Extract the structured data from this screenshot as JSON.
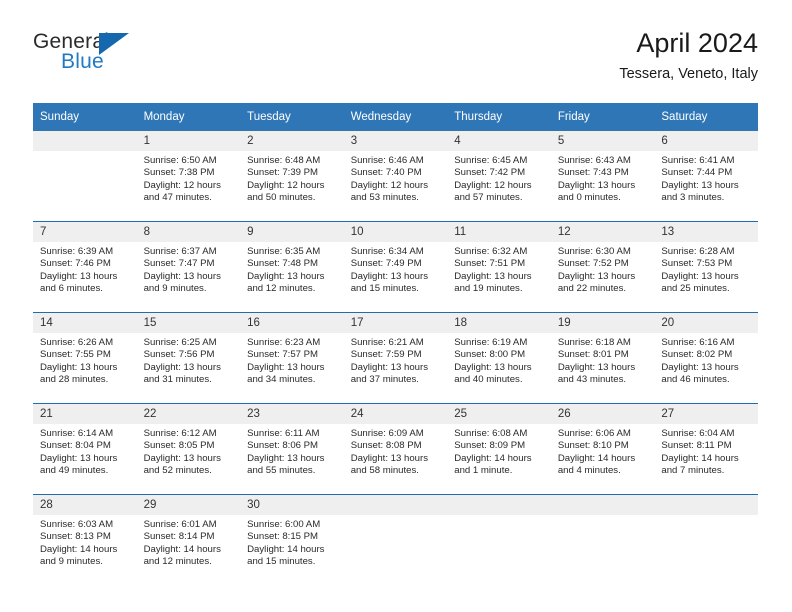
{
  "brand": {
    "name_top": "General",
    "name_bottom": "Blue",
    "flag_icon": "triangle-flag-icon"
  },
  "header": {
    "title": "April 2024",
    "subtitle": "Tessera, Veneto, Italy"
  },
  "colors": {
    "header_blue": "#2F76B6",
    "divider_blue": "#1F6CB0",
    "daynum_bg": "#EFEFEF",
    "brand_blue": "#1F7AC4",
    "text": "#1A1A1A"
  },
  "calendar": {
    "weekdays": [
      "Sunday",
      "Monday",
      "Tuesday",
      "Wednesday",
      "Thursday",
      "Friday",
      "Saturday"
    ],
    "labels": {
      "sunrise": "Sunrise:",
      "sunset": "Sunset:",
      "daylight": "Daylight:"
    },
    "weeks": [
      [
        {
          "day": "",
          "sunrise": "",
          "sunset": "",
          "daylight": ""
        },
        {
          "day": "1",
          "sunrise": "Sunrise: 6:50 AM",
          "sunset": "Sunset: 7:38 PM",
          "daylight": "Daylight: 12 hours and 47 minutes."
        },
        {
          "day": "2",
          "sunrise": "Sunrise: 6:48 AM",
          "sunset": "Sunset: 7:39 PM",
          "daylight": "Daylight: 12 hours and 50 minutes."
        },
        {
          "day": "3",
          "sunrise": "Sunrise: 6:46 AM",
          "sunset": "Sunset: 7:40 PM",
          "daylight": "Daylight: 12 hours and 53 minutes."
        },
        {
          "day": "4",
          "sunrise": "Sunrise: 6:45 AM",
          "sunset": "Sunset: 7:42 PM",
          "daylight": "Daylight: 12 hours and 57 minutes."
        },
        {
          "day": "5",
          "sunrise": "Sunrise: 6:43 AM",
          "sunset": "Sunset: 7:43 PM",
          "daylight": "Daylight: 13 hours and 0 minutes."
        },
        {
          "day": "6",
          "sunrise": "Sunrise: 6:41 AM",
          "sunset": "Sunset: 7:44 PM",
          "daylight": "Daylight: 13 hours and 3 minutes."
        }
      ],
      [
        {
          "day": "7",
          "sunrise": "Sunrise: 6:39 AM",
          "sunset": "Sunset: 7:46 PM",
          "daylight": "Daylight: 13 hours and 6 minutes."
        },
        {
          "day": "8",
          "sunrise": "Sunrise: 6:37 AM",
          "sunset": "Sunset: 7:47 PM",
          "daylight": "Daylight: 13 hours and 9 minutes."
        },
        {
          "day": "9",
          "sunrise": "Sunrise: 6:35 AM",
          "sunset": "Sunset: 7:48 PM",
          "daylight": "Daylight: 13 hours and 12 minutes."
        },
        {
          "day": "10",
          "sunrise": "Sunrise: 6:34 AM",
          "sunset": "Sunset: 7:49 PM",
          "daylight": "Daylight: 13 hours and 15 minutes."
        },
        {
          "day": "11",
          "sunrise": "Sunrise: 6:32 AM",
          "sunset": "Sunset: 7:51 PM",
          "daylight": "Daylight: 13 hours and 19 minutes."
        },
        {
          "day": "12",
          "sunrise": "Sunrise: 6:30 AM",
          "sunset": "Sunset: 7:52 PM",
          "daylight": "Daylight: 13 hours and 22 minutes."
        },
        {
          "day": "13",
          "sunrise": "Sunrise: 6:28 AM",
          "sunset": "Sunset: 7:53 PM",
          "daylight": "Daylight: 13 hours and 25 minutes."
        }
      ],
      [
        {
          "day": "14",
          "sunrise": "Sunrise: 6:26 AM",
          "sunset": "Sunset: 7:55 PM",
          "daylight": "Daylight: 13 hours and 28 minutes."
        },
        {
          "day": "15",
          "sunrise": "Sunrise: 6:25 AM",
          "sunset": "Sunset: 7:56 PM",
          "daylight": "Daylight: 13 hours and 31 minutes."
        },
        {
          "day": "16",
          "sunrise": "Sunrise: 6:23 AM",
          "sunset": "Sunset: 7:57 PM",
          "daylight": "Daylight: 13 hours and 34 minutes."
        },
        {
          "day": "17",
          "sunrise": "Sunrise: 6:21 AM",
          "sunset": "Sunset: 7:59 PM",
          "daylight": "Daylight: 13 hours and 37 minutes."
        },
        {
          "day": "18",
          "sunrise": "Sunrise: 6:19 AM",
          "sunset": "Sunset: 8:00 PM",
          "daylight": "Daylight: 13 hours and 40 minutes."
        },
        {
          "day": "19",
          "sunrise": "Sunrise: 6:18 AM",
          "sunset": "Sunset: 8:01 PM",
          "daylight": "Daylight: 13 hours and 43 minutes."
        },
        {
          "day": "20",
          "sunrise": "Sunrise: 6:16 AM",
          "sunset": "Sunset: 8:02 PM",
          "daylight": "Daylight: 13 hours and 46 minutes."
        }
      ],
      [
        {
          "day": "21",
          "sunrise": "Sunrise: 6:14 AM",
          "sunset": "Sunset: 8:04 PM",
          "daylight": "Daylight: 13 hours and 49 minutes."
        },
        {
          "day": "22",
          "sunrise": "Sunrise: 6:12 AM",
          "sunset": "Sunset: 8:05 PM",
          "daylight": "Daylight: 13 hours and 52 minutes."
        },
        {
          "day": "23",
          "sunrise": "Sunrise: 6:11 AM",
          "sunset": "Sunset: 8:06 PM",
          "daylight": "Daylight: 13 hours and 55 minutes."
        },
        {
          "day": "24",
          "sunrise": "Sunrise: 6:09 AM",
          "sunset": "Sunset: 8:08 PM",
          "daylight": "Daylight: 13 hours and 58 minutes."
        },
        {
          "day": "25",
          "sunrise": "Sunrise: 6:08 AM",
          "sunset": "Sunset: 8:09 PM",
          "daylight": "Daylight: 14 hours and 1 minute."
        },
        {
          "day": "26",
          "sunrise": "Sunrise: 6:06 AM",
          "sunset": "Sunset: 8:10 PM",
          "daylight": "Daylight: 14 hours and 4 minutes."
        },
        {
          "day": "27",
          "sunrise": "Sunrise: 6:04 AM",
          "sunset": "Sunset: 8:11 PM",
          "daylight": "Daylight: 14 hours and 7 minutes."
        }
      ],
      [
        {
          "day": "28",
          "sunrise": "Sunrise: 6:03 AM",
          "sunset": "Sunset: 8:13 PM",
          "daylight": "Daylight: 14 hours and 9 minutes."
        },
        {
          "day": "29",
          "sunrise": "Sunrise: 6:01 AM",
          "sunset": "Sunset: 8:14 PM",
          "daylight": "Daylight: 14 hours and 12 minutes."
        },
        {
          "day": "30",
          "sunrise": "Sunrise: 6:00 AM",
          "sunset": "Sunset: 8:15 PM",
          "daylight": "Daylight: 14 hours and 15 minutes."
        },
        {
          "day": "",
          "sunrise": "",
          "sunset": "",
          "daylight": ""
        },
        {
          "day": "",
          "sunrise": "",
          "sunset": "",
          "daylight": ""
        },
        {
          "day": "",
          "sunrise": "",
          "sunset": "",
          "daylight": ""
        },
        {
          "day": "",
          "sunrise": "",
          "sunset": "",
          "daylight": ""
        }
      ]
    ]
  }
}
